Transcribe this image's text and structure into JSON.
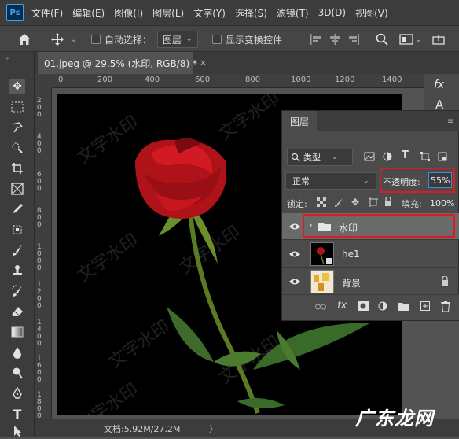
{
  "app": {
    "logo": "Ps"
  },
  "menu": [
    "文件(F)",
    "编辑(E)",
    "图像(I)",
    "图层(L)",
    "文字(Y)",
    "选择(S)",
    "滤镜(T)",
    "3D(D)",
    "视图(V)"
  ],
  "options": {
    "auto_select_label": "自动选择：",
    "auto_select_value": "图层",
    "show_transform_label": "显示变换控件"
  },
  "document": {
    "tab_title": "01.jpeg @ 29.5% (水印, RGB/8) *",
    "close": "×"
  },
  "ruler": {
    "top_ticks": [
      "0",
      "200",
      "400",
      "600",
      "800",
      "1000",
      "1200",
      "1400"
    ],
    "left_ticks": [
      "2 0 0",
      "4 0 0",
      "6 0 0",
      "8 0 0",
      "1 0 0 0",
      "1 2 0 0",
      "1 4 0 0",
      "1 6 0 0",
      "1 8 0 0"
    ]
  },
  "canvas": {
    "watermark_text": "文字水印"
  },
  "status": {
    "text": "文档:5.92M/27.2M",
    "arrow": "〉"
  },
  "layers_panel": {
    "tab": "图层",
    "filter_kind": "类型",
    "blend_mode": "正常",
    "opacity_label": "不透明度:",
    "opacity_value": "55%",
    "lock_label": "锁定:",
    "fill_label": "填充:",
    "fill_value": "100%",
    "layers": [
      {
        "name": "水印",
        "type": "group",
        "selected": true
      },
      {
        "name": "he1",
        "type": "smart-object"
      },
      {
        "name": "背景",
        "type": "background",
        "locked": true
      }
    ]
  },
  "brand": {
    "site_logo": "广东龙网"
  },
  "colors": {
    "highlight": "#e01a24",
    "accent": "#31a8ff"
  }
}
